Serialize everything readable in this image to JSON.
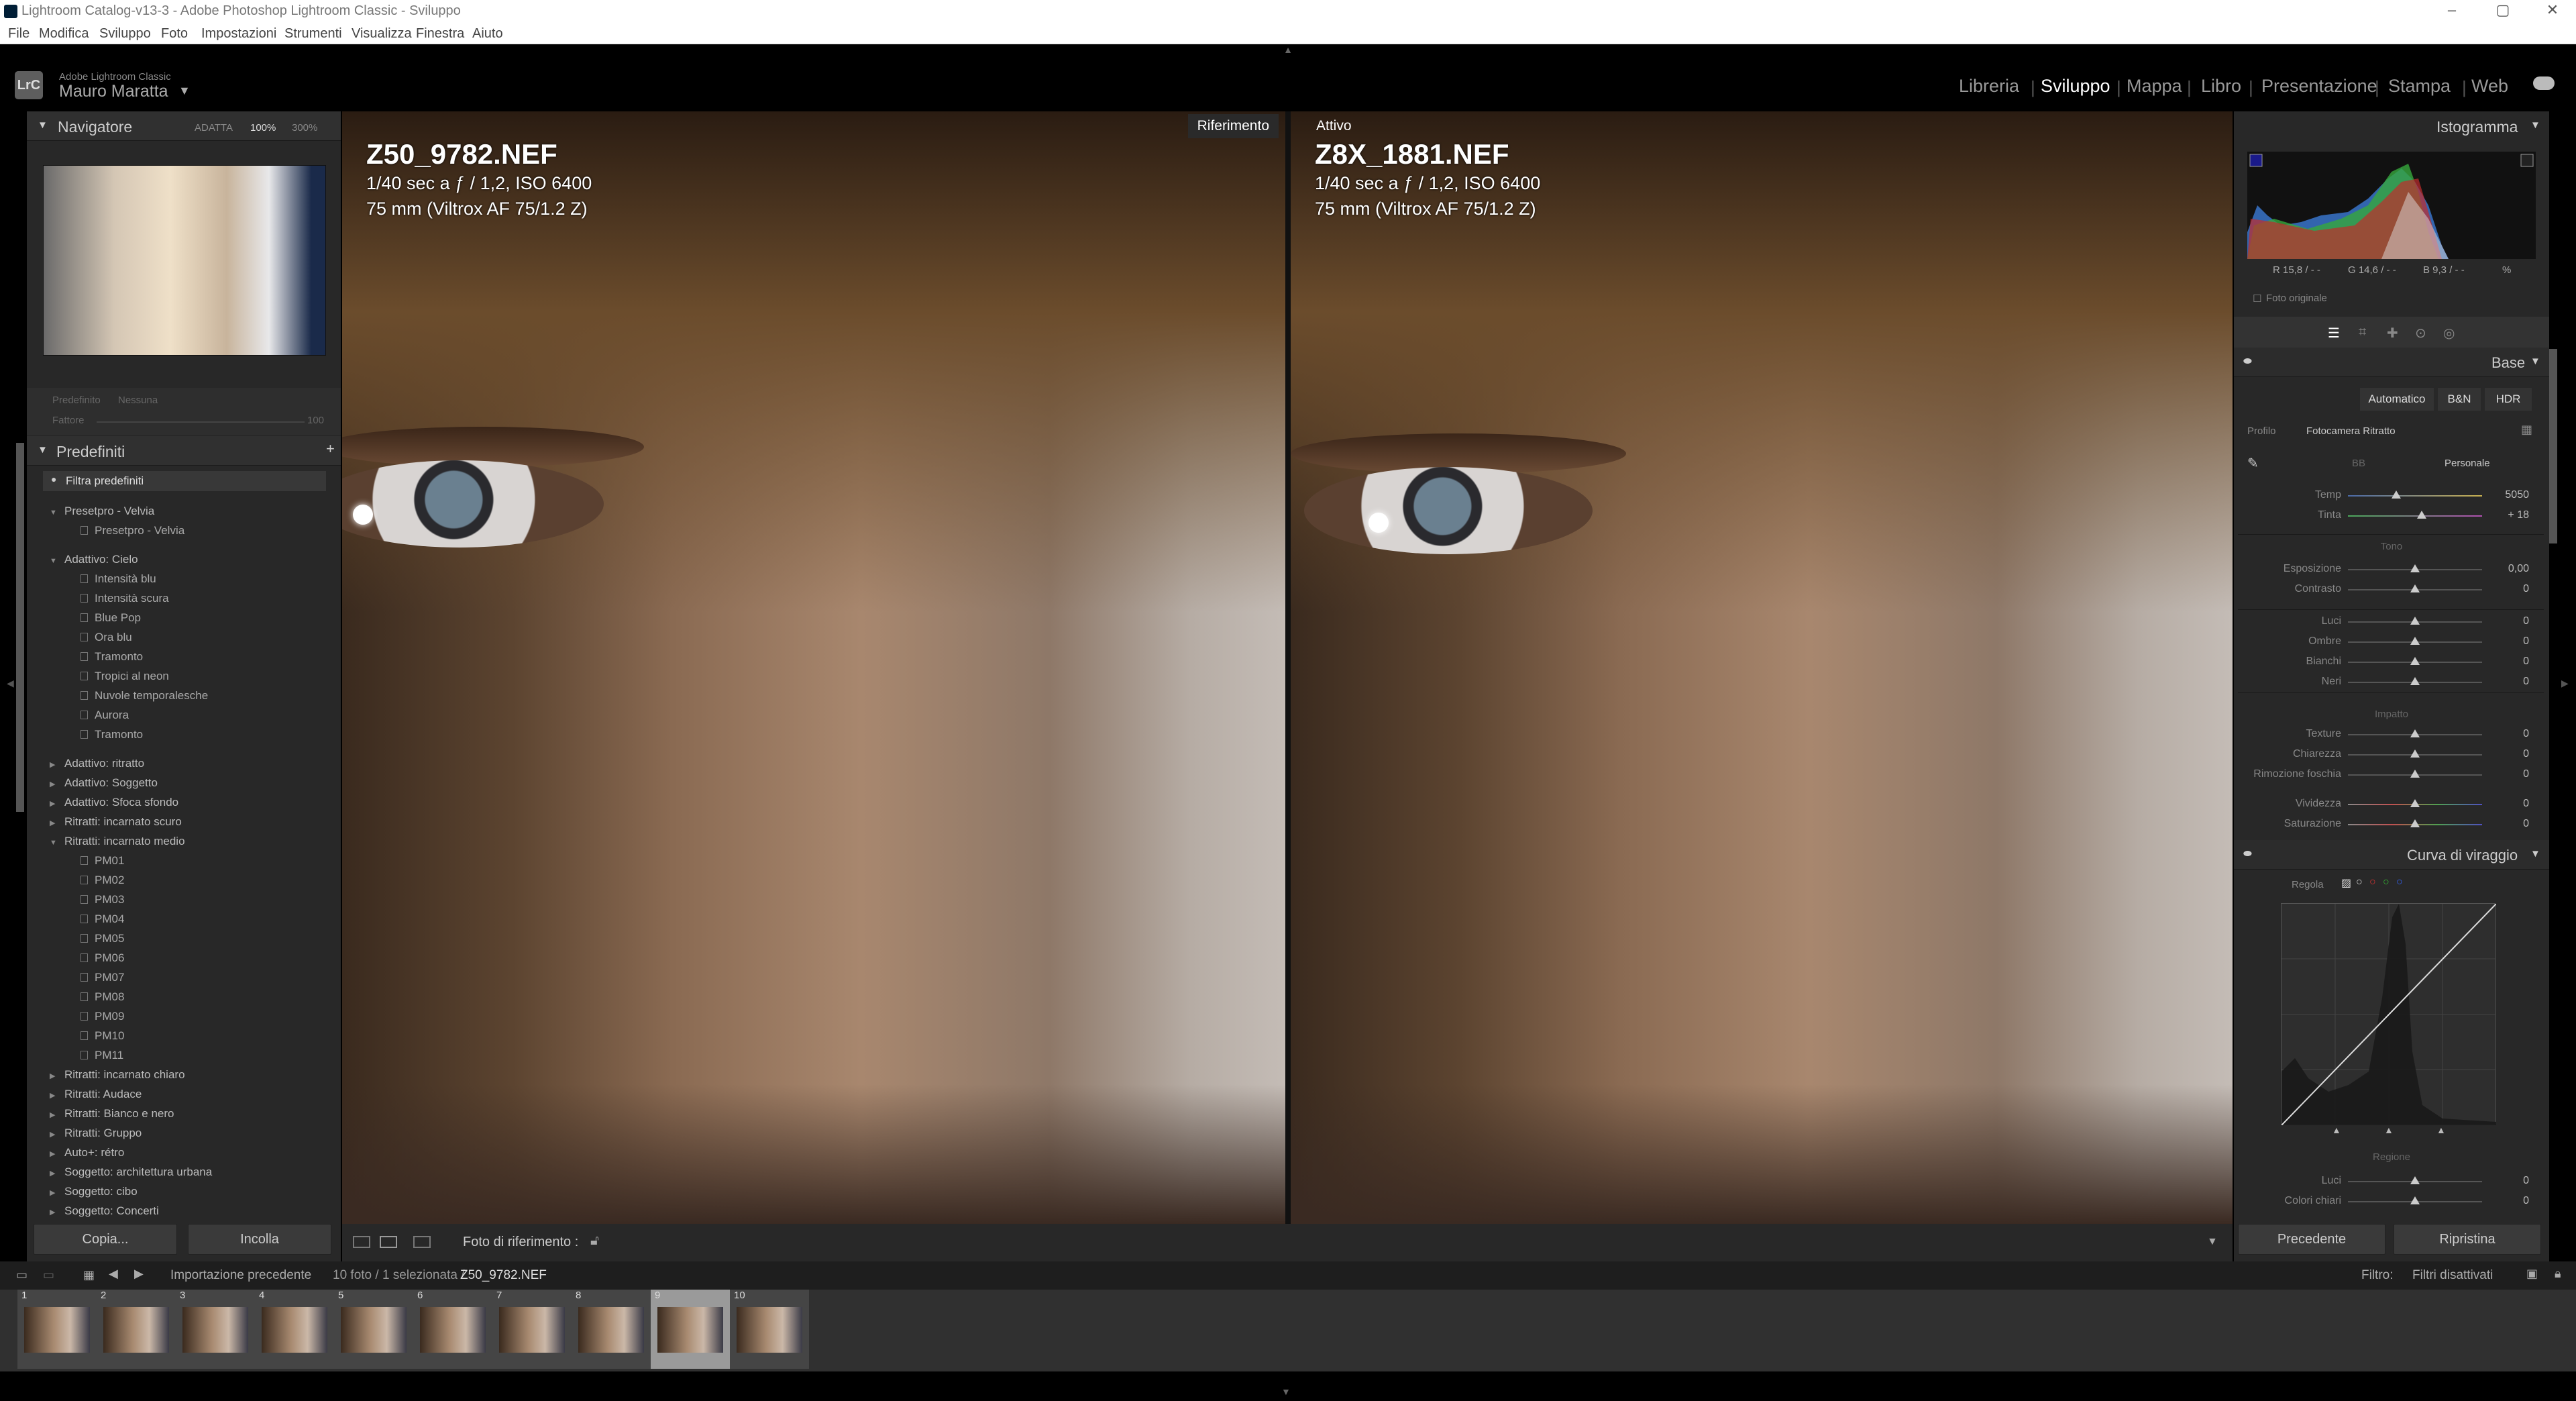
{
  "titlebar": {
    "title": "Lightroom Catalog-v13-3 - Adobe Photoshop Lightroom Classic - Sviluppo"
  },
  "menu": [
    "File",
    "Modifica",
    "Sviluppo",
    "Foto",
    "Impostazioni",
    "Strumenti",
    "Visualizza",
    "Finestra",
    "Aiuto"
  ],
  "identity": {
    "logo": "LrC",
    "product": "Adobe Lightroom Classic",
    "user": "Mauro Maratta"
  },
  "modules": [
    {
      "label": "Libreria"
    },
    {
      "label": "Sviluppo",
      "active": true
    },
    {
      "label": "Mappa"
    },
    {
      "label": "Libro"
    },
    {
      "label": "Presentazione"
    },
    {
      "label": "Stampa"
    },
    {
      "label": "Web"
    }
  ],
  "navigator": {
    "title": "Navigatore",
    "opts": [
      "ADATTA",
      "100%",
      "300%"
    ]
  },
  "preset_amount": {
    "label1": "Predefinito",
    "label2": "Nessuna",
    "fattore": "Fattore",
    "max": "100"
  },
  "presets": {
    "title": "Predefiniti",
    "filter": "Filtra predefiniti",
    "items": [
      {
        "label": "Presetpro - Velvia",
        "group": true,
        "open": true
      },
      {
        "label": "Presetpro - Velvia",
        "group": false
      },
      {
        "label": "Adattivo: Cielo",
        "group": true,
        "open": true
      },
      {
        "label": "Intensità blu",
        "group": false
      },
      {
        "label": "Intensità scura",
        "group": false
      },
      {
        "label": "Blue Pop",
        "group": false
      },
      {
        "label": "Ora blu",
        "group": false
      },
      {
        "label": "Tramonto",
        "group": false
      },
      {
        "label": "Tropici al neon",
        "group": false
      },
      {
        "label": "Nuvole temporalesche",
        "group": false
      },
      {
        "label": "Aurora",
        "group": false
      },
      {
        "label": "Tramonto",
        "group": false
      },
      {
        "label": "Adattivo: ritratto",
        "group": true
      },
      {
        "label": "Adattivo: Soggetto",
        "group": true
      },
      {
        "label": "Adattivo: Sfoca sfondo",
        "group": true
      },
      {
        "label": "Ritratti: incarnato scuro",
        "group": true
      },
      {
        "label": "Ritratti: incarnato medio",
        "group": true,
        "open": true
      },
      {
        "label": "PM01",
        "group": false
      },
      {
        "label": "PM02",
        "group": false
      },
      {
        "label": "PM03",
        "group": false
      },
      {
        "label": "PM04",
        "group": false
      },
      {
        "label": "PM05",
        "group": false
      },
      {
        "label": "PM06",
        "group": false
      },
      {
        "label": "PM07",
        "group": false
      },
      {
        "label": "PM08",
        "group": false
      },
      {
        "label": "PM09",
        "group": false
      },
      {
        "label": "PM10",
        "group": false
      },
      {
        "label": "PM11",
        "group": false
      },
      {
        "label": "Ritratti: incarnato chiaro",
        "group": true
      },
      {
        "label": "Ritratti: Audace",
        "group": true
      },
      {
        "label": "Ritratti: Bianco e nero",
        "group": true
      },
      {
        "label": "Ritratti: Gruppo",
        "group": true
      },
      {
        "label": "Auto+: rétro",
        "group": true
      },
      {
        "label": "Soggetto: architettura urbana",
        "group": true
      },
      {
        "label": "Soggetto: cibo",
        "group": true
      },
      {
        "label": "Soggetto: Concerti",
        "group": true
      }
    ]
  },
  "left_buttons": {
    "copy": "Copia...",
    "paste": "Incolla"
  },
  "viewer": {
    "left": {
      "badge": "Riferimento",
      "name": "Z50_9782.NEF",
      "exposure": "1/40 sec a ƒ / 1,2, ISO 6400",
      "lens": "75 mm (Viltrox AF 75/1.2 Z)"
    },
    "right": {
      "badge": "Attivo",
      "name": "Z8X_1881.NEF",
      "exposure": "1/40 sec a ƒ / 1,2, ISO 6400",
      "lens": "75 mm (Viltrox AF 75/1.2 Z)"
    }
  },
  "toolbar": {
    "ref_label": "Foto di riferimento :"
  },
  "histogram": {
    "title": "Istogramma",
    "r": "R 15,8 / - -",
    "g": "G 14,6 / - -",
    "b": "B 9,3 / - -",
    "pct": "%",
    "original": "Foto originale"
  },
  "basic": {
    "title": "Base",
    "buttons": [
      "Automatico",
      "B&N",
      "HDR"
    ],
    "profile_label": "Profilo",
    "profile_value": "Fotocamera Ritratto",
    "wb_label": "BB",
    "wb_value": "Personale",
    "sliders_wb": [
      {
        "label": "Temp",
        "value": "5050",
        "pos": 0.36
      },
      {
        "label": "Tinta",
        "value": "+ 18",
        "pos": 0.55
      }
    ],
    "tone_label": "Tono",
    "sliders_tone": [
      {
        "label": "Esposizione",
        "value": "0,00",
        "pos": 0.5
      },
      {
        "label": "Contrasto",
        "value": "0",
        "pos": 0.5
      }
    ],
    "sliders_tone2": [
      {
        "label": "Luci",
        "value": "0",
        "pos": 0.5
      },
      {
        "label": "Ombre",
        "value": "0",
        "pos": 0.5
      },
      {
        "label": "Bianchi",
        "value": "0",
        "pos": 0.5
      },
      {
        "label": "Neri",
        "value": "0",
        "pos": 0.5
      }
    ],
    "presence_label": "Impatto",
    "sliders_presence": [
      {
        "label": "Texture",
        "value": "0",
        "pos": 0.5
      },
      {
        "label": "Chiarezza",
        "value": "0",
        "pos": 0.5
      },
      {
        "label": "Rimozione foschia",
        "value": "0",
        "pos": 0.5
      }
    ],
    "sliders_presence2": [
      {
        "label": "Vividezza",
        "value": "0",
        "pos": 0.5
      },
      {
        "label": "Saturazione",
        "value": "0",
        "pos": 0.5
      }
    ]
  },
  "curve": {
    "title": "Curva di viraggio",
    "regola": "Regola",
    "region": "Regione",
    "sliders": [
      {
        "label": "Luci",
        "value": "0",
        "pos": 0.5
      },
      {
        "label": "Colori chiari",
        "value": "0",
        "pos": 0.5
      }
    ]
  },
  "right_buttons": {
    "prev": "Precedente",
    "reset": "Ripristina"
  },
  "filmstrip_bar": {
    "source": "Importazione precedente",
    "count": "10 foto / 1 selezionata /",
    "file": "Z50_9782.NEF",
    "filter_label": "Filtro:",
    "filter_value": "Filtri disattivati"
  },
  "thumbs": [
    "1",
    "2",
    "3",
    "4",
    "5",
    "6",
    "7",
    "8",
    "9",
    "10"
  ],
  "selected_thumb": 9
}
